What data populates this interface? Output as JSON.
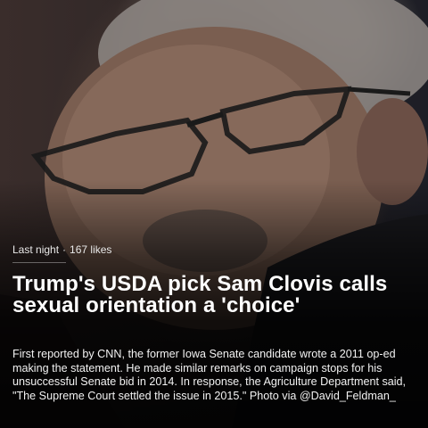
{
  "post": {
    "time": "Last night",
    "separator": "·",
    "likes": "167 likes",
    "headline": "Trump's USDA pick Sam Clovis calls sexual orientation a 'choice'",
    "body": "First reported by CNN, the former Iowa Senate candidate wrote a 2011 op-ed making the statement. He made similar remarks on campaign stops for his unsuccessful Senate bid in 2014. In response, the Agriculture Department said, \"The Supreme Court settled the issue in 2015.\" Photo via @David_Feldman_"
  },
  "colors": {
    "text_primary": "#ffffff",
    "text_secondary": "#e9e9e9",
    "overlay": "#000000"
  }
}
